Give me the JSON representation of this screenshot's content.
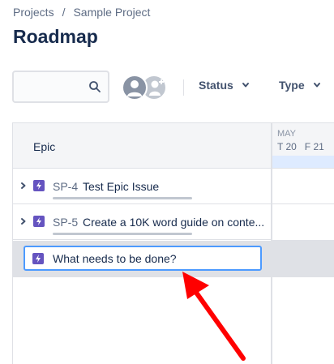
{
  "breadcrumb": {
    "items": [
      "Projects",
      "Sample Project"
    ],
    "separator": "/"
  },
  "page": {
    "title": "Roadmap"
  },
  "toolbar": {
    "search": {
      "value": "",
      "placeholder": "",
      "icon": "search-icon"
    },
    "status_label": "Status",
    "type_label": "Type"
  },
  "grid": {
    "epic_header": "Epic",
    "month": "MAY",
    "days": [
      "T 20",
      "F 21"
    ],
    "rows": [
      {
        "key": "SP-4",
        "summary": "Test Epic Issue"
      },
      {
        "key": "SP-5",
        "summary": "Create a 10K word guide on conte..."
      }
    ],
    "create": {
      "placeholder": "What needs to be done?"
    }
  },
  "colors": {
    "epic_icon": "#6554c0",
    "focus_border": "#4c9aff",
    "annotation_arrow": "#ff0000"
  }
}
